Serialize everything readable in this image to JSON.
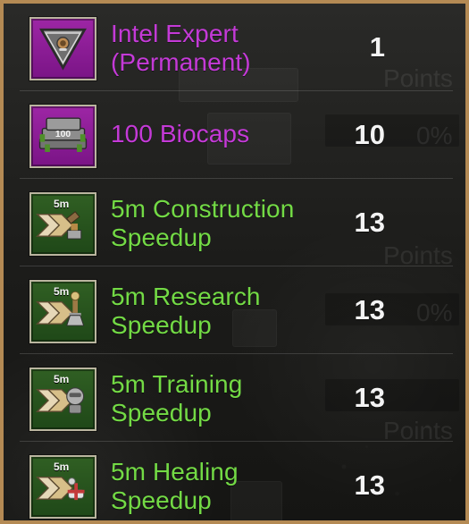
{
  "background": {
    "ghost_points": "Points",
    "ghost_percent": "0%"
  },
  "items": [
    {
      "title_line1": "Intel Expert",
      "title_line2": "(Permanent)",
      "quantity": "1",
      "rarity": "purple",
      "icon_name": "intel-expert-icon"
    },
    {
      "title_line1": "100 Biocaps",
      "title_line2": "",
      "quantity": "10",
      "rarity": "purple",
      "icon_name": "biocaps-icon",
      "icon_text": "100"
    },
    {
      "title_line1": "5m Construction",
      "title_line2": "Speedup",
      "quantity": "13",
      "rarity": "green",
      "icon_name": "construction-speedup-icon",
      "icon_time": "5m"
    },
    {
      "title_line1": "5m Research",
      "title_line2": "Speedup",
      "quantity": "13",
      "rarity": "green",
      "icon_name": "research-speedup-icon",
      "icon_time": "5m"
    },
    {
      "title_line1": "5m Training",
      "title_line2": "Speedup",
      "quantity": "13",
      "rarity": "green",
      "icon_name": "training-speedup-icon",
      "icon_time": "5m"
    },
    {
      "title_line1": "5m Healing",
      "title_line2": "Speedup",
      "quantity": "13",
      "rarity": "green",
      "icon_name": "healing-speedup-icon",
      "icon_time": "5m"
    }
  ],
  "colors": {
    "frame_border": "#b48a54",
    "purple_text": "#c43ad7",
    "green_text": "#73da45",
    "purple_tile": "#8f1f9a",
    "green_tile": "#2a5420",
    "quantity_text": "#f3f3f3"
  }
}
